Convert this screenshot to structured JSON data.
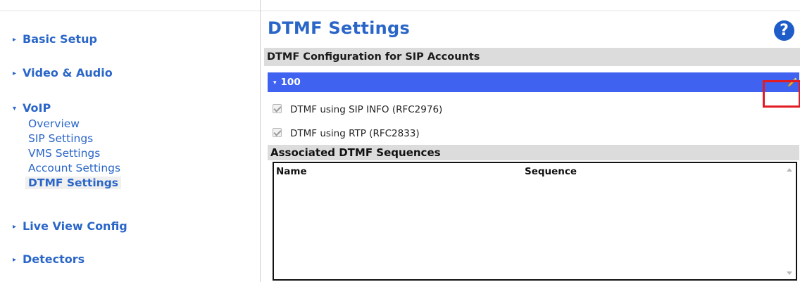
{
  "sidebar": {
    "sections": [
      {
        "label": "Basic Setup",
        "expanded": false
      },
      {
        "label": "Video & Audio",
        "expanded": false
      },
      {
        "label": "VoIP",
        "expanded": true
      },
      {
        "label": "Live View Config",
        "expanded": false
      },
      {
        "label": "Detectors",
        "expanded": false
      }
    ],
    "voip_items": [
      {
        "label": "Overview"
      },
      {
        "label": "SIP Settings"
      },
      {
        "label": "VMS Settings"
      },
      {
        "label": "Account Settings"
      },
      {
        "label": "DTMF Settings",
        "active": true
      }
    ],
    "caret_collapsed": "▸",
    "caret_expanded": "▾"
  },
  "main": {
    "title": "DTMF Settings",
    "help_icon": "?",
    "section_title": "DTMF Configuration for SIP Accounts",
    "account": {
      "caret": "▾",
      "name": "100",
      "edit_icon": "pencil-icon"
    },
    "options": [
      {
        "label": "DTMF using SIP INFO (RFC2976)",
        "checked": true,
        "disabled": true
      },
      {
        "label": "DTMF using RTP (RFC2833)",
        "checked": true,
        "disabled": true
      }
    ],
    "sequences": {
      "title": "Associated DTMF Sequences",
      "columns": [
        "Name",
        "Sequence"
      ],
      "rows": []
    }
  },
  "colors": {
    "link": "#2a66c8",
    "account_bar": "#3f63f0",
    "highlight": "#e31b23",
    "header_bg": "#dcdcdc"
  }
}
